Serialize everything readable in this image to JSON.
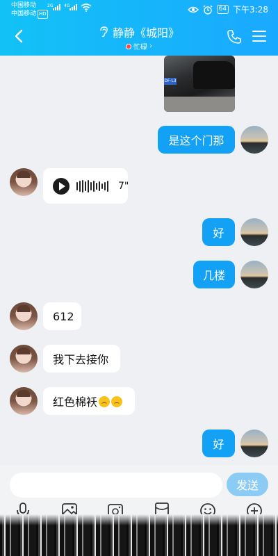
{
  "status_bar": {
    "carrier1": "中国移动",
    "carrier2": "中国移动",
    "hd": "HD",
    "net1": "2G",
    "net2": "4G",
    "battery": "64",
    "time": "下午3:28"
  },
  "header": {
    "title": "静静《城阳》",
    "presence": "忙碌",
    "presence_chevron": "›"
  },
  "messages": [
    {
      "type": "image",
      "side": "outgoing"
    },
    {
      "type": "text",
      "side": "outgoing",
      "text": "是这个门那"
    },
    {
      "type": "voice",
      "side": "incoming",
      "duration": "7\""
    },
    {
      "type": "text",
      "side": "outgoing",
      "text": "好"
    },
    {
      "type": "text",
      "side": "outgoing",
      "text": "几楼"
    },
    {
      "type": "text",
      "side": "incoming",
      "text": "612"
    },
    {
      "type": "text",
      "side": "incoming",
      "text": "我下去接你"
    },
    {
      "type": "text",
      "side": "incoming",
      "text": "红色棉袄",
      "emoji": [
        "sweat-smile-emoji",
        "sweat-smile-emoji"
      ]
    },
    {
      "type": "text",
      "side": "outgoing",
      "text": "好"
    }
  ],
  "composer": {
    "input_value": "",
    "send_label": "发送",
    "tools": [
      "microphone-icon",
      "image-icon",
      "camera-icon",
      "red-packet-icon",
      "emoji-icon",
      "plus-icon"
    ]
  },
  "colors": {
    "header_start": "#12c2f6",
    "header_end": "#1aa9ff",
    "outgoing_bubble": "#12a1f5",
    "incoming_bubble": "#ffffff",
    "chat_background": "#eef0f3",
    "send_button": "#8ccbf3"
  }
}
